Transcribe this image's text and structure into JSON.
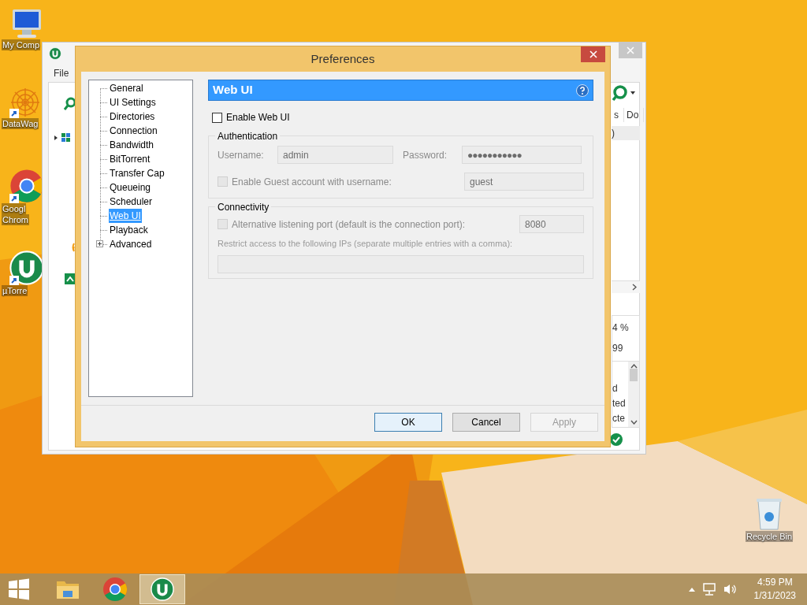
{
  "desktop": {
    "icons": [
      {
        "kind": "computer",
        "lines": [
          "My Comp"
        ]
      },
      {
        "kind": "mandala",
        "lines": [
          "DataWag"
        ]
      },
      {
        "kind": "chrome",
        "lines": [
          "Googl",
          "Chrom"
        ]
      },
      {
        "kind": "utorrent",
        "lines": [
          "µTorre"
        ]
      },
      {
        "kind": "recycle",
        "lines": [
          "Recycle Bin"
        ]
      }
    ]
  },
  "background_window": {
    "menu": [
      "File"
    ],
    "column_fragments": [
      "s",
      "Do"
    ],
    "cell_fragment": ")",
    "stat_fragments": [
      "4 %",
      "99"
    ],
    "list_fragments": [
      "d",
      "ted",
      "cte"
    ]
  },
  "dialog": {
    "title": "Preferences",
    "tree": [
      {
        "label": "General",
        "selected": false
      },
      {
        "label": "UI Settings",
        "selected": false
      },
      {
        "label": "Directories",
        "selected": false
      },
      {
        "label": "Connection",
        "selected": false
      },
      {
        "label": "Bandwidth",
        "selected": false
      },
      {
        "label": "BitTorrent",
        "selected": false
      },
      {
        "label": "Transfer Cap",
        "selected": false
      },
      {
        "label": "Queueing",
        "selected": false
      },
      {
        "label": "Scheduler",
        "selected": false
      },
      {
        "label": "Web UI",
        "selected": true
      },
      {
        "label": "Playback",
        "selected": false
      },
      {
        "label": "Advanced",
        "selected": false,
        "expanded": false
      }
    ],
    "section_title": "Web UI",
    "enable": {
      "label": "Enable Web UI",
      "checked": false
    },
    "authentication": {
      "title": "Authentication",
      "username_label": "Username:",
      "username": "admin",
      "password_label": "Password:",
      "password": "●●●●●●●●●●●",
      "guest": {
        "label": "Enable Guest account with username:",
        "checked": false,
        "disabled": true
      },
      "guest_name": "guest"
    },
    "connectivity": {
      "title": "Connectivity",
      "alt_port": {
        "label": "Alternative listening port (default is the connection port):",
        "checked": false,
        "disabled": true
      },
      "port": "8080",
      "restrict_label": "Restrict access to the following IPs (separate multiple entries with a comma):"
    },
    "buttons": [
      {
        "label": "OK",
        "disabled": false,
        "default": true
      },
      {
        "label": "Cancel",
        "disabled": false,
        "default": false
      },
      {
        "label": "Apply",
        "disabled": true,
        "default": false
      }
    ]
  },
  "taskbar": {
    "items": [
      {
        "kind": "explorer",
        "selected": false
      },
      {
        "kind": "chrome",
        "selected": false
      },
      {
        "kind": "utorrent",
        "selected": true
      }
    ],
    "time": "4:59 PM",
    "date": "1/31/2023"
  }
}
